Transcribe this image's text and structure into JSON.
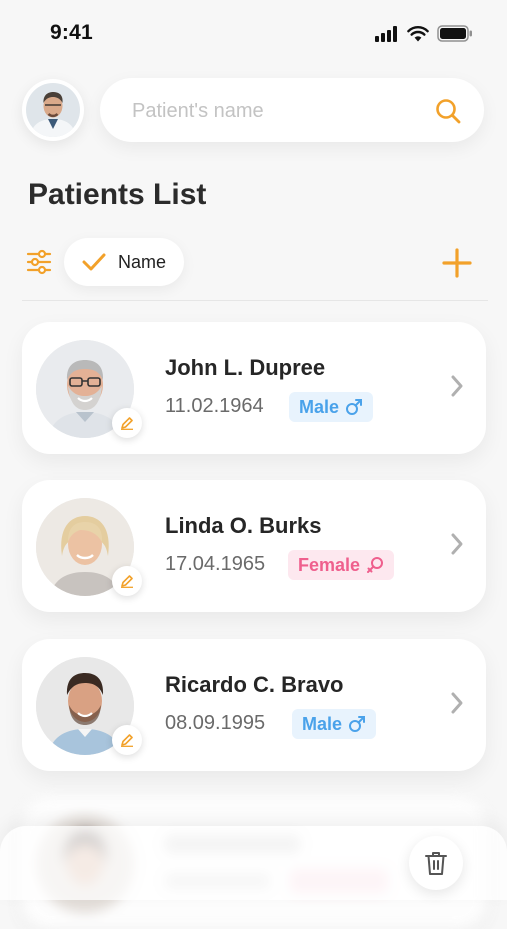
{
  "status_bar": {
    "time": "9:41",
    "signal_icon": "signal-icon",
    "wifi_icon": "wifi-icon",
    "battery_icon": "battery-icon"
  },
  "header": {
    "avatar_icon": "doctor-avatar",
    "search": {
      "placeholder": "Patient's name",
      "value": "",
      "icon": "search-icon"
    }
  },
  "title": "Patients List",
  "filters": {
    "filter_icon": "filter-sliders-icon",
    "chip_label": "Name",
    "chip_icon": "check-icon",
    "add_icon": "plus-icon"
  },
  "patients": [
    {
      "name": "John L. Dupree",
      "dob": "11.02.1964",
      "gender": "Male"
    },
    {
      "name": "Linda O. Burks",
      "dob": "17.04.1965",
      "gender": "Female"
    },
    {
      "name": "Ricardo C. Bravo",
      "dob": "08.09.1995",
      "gender": "Male"
    }
  ],
  "bottom": {
    "trash_icon": "trash-icon"
  },
  "colors": {
    "accent": "#f2a12a",
    "male": "#4aa2ea",
    "male_bg": "#e8f3fd",
    "female": "#ef5f8d",
    "female_bg": "#fde8ef",
    "background": "#f7f7f7"
  }
}
